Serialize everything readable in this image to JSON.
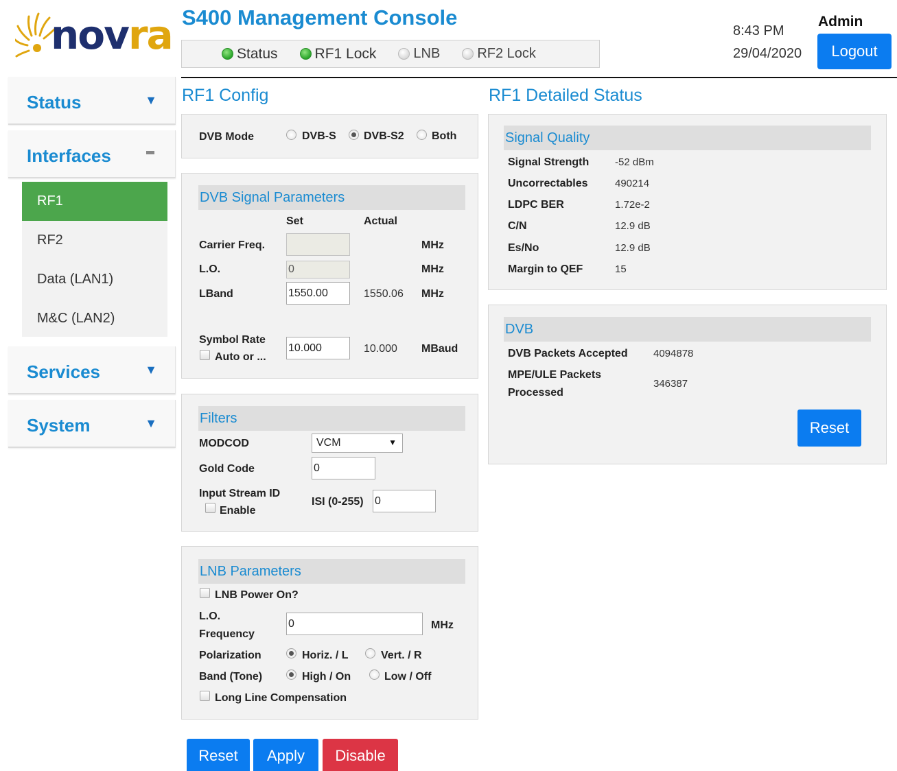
{
  "header": {
    "logo_text": "novra",
    "app_title": "S400 Management Console",
    "time": "8:43 PM",
    "date": "29/04/2020",
    "user": "Admin",
    "logout_label": "Logout"
  },
  "status_indicators": [
    {
      "label": "Status",
      "state": "on"
    },
    {
      "label": "RF1 Lock",
      "state": "on"
    },
    {
      "label": "LNB",
      "state": "off"
    },
    {
      "label": "RF2 Lock",
      "state": "off"
    }
  ],
  "colors": {
    "accent_blue": "#1a8bd1",
    "button_blue": "#0b7cf0",
    "active_green": "#4ca64c",
    "danger_red": "#dc3545",
    "led_on": "#2aa52a"
  },
  "sidebar": {
    "sections": [
      {
        "label": "Status",
        "icon": "chevron-down-icon"
      },
      {
        "label": "Interfaces",
        "icon": "collapse-icon"
      },
      {
        "label": "Services",
        "icon": "chevron-down-icon"
      },
      {
        "label": "System",
        "icon": "chevron-down-icon"
      }
    ],
    "interfaces": [
      "RF1",
      "RF2",
      "Data (LAN1)",
      "M&C (LAN2)"
    ],
    "active_interface": "RF1"
  },
  "rf1_config": {
    "title": "RF1 Config",
    "dvb_mode": {
      "label": "DVB Mode",
      "options": [
        "DVB-S",
        "DVB-S2",
        "Both"
      ],
      "selected": "DVB-S2"
    },
    "signal_params": {
      "title": "DVB Signal Parameters",
      "col_set": "Set",
      "col_actual": "Actual",
      "carrier_freq": {
        "label": "Carrier Freq.",
        "set": "",
        "unit": "MHz"
      },
      "lo": {
        "label": "L.O.",
        "set": "0",
        "unit": "MHz"
      },
      "lband": {
        "label": "LBand",
        "set": "1550.00",
        "actual": "1550.06",
        "unit": "MHz"
      },
      "symbol_rate": {
        "label": "Symbol Rate",
        "auto_label": "Auto or ...",
        "set": "10.000",
        "actual": "10.000",
        "unit": "MBaud"
      }
    },
    "filters": {
      "title": "Filters",
      "modcod_label": "MODCOD",
      "modcod_value": "VCM",
      "gold_code_label": "Gold Code",
      "gold_code_value": "0",
      "isid_label": "Input Stream ID",
      "isid_enable_label": "Enable",
      "isi_label": "ISI (0-255)",
      "isi_value": "0"
    },
    "lnb": {
      "title": "LNB Parameters",
      "power_label": "LNB Power On?",
      "lo_label_1": "L.O.",
      "lo_label_2": "Frequency",
      "lo_value": "0",
      "lo_unit": "MHz",
      "polarization_label": "Polarization",
      "pol_options": [
        "Horiz. / L",
        "Vert. / R"
      ],
      "pol_selected": "Horiz. / L",
      "band_label": "Band (Tone)",
      "band_options": [
        "High / On",
        "Low / Off"
      ],
      "band_selected": "High / On",
      "long_line_label": "Long Line Compensation"
    },
    "buttons": {
      "reset": "Reset",
      "apply": "Apply",
      "disable": "Disable"
    }
  },
  "rf1_status": {
    "title": "RF1 Detailed Status",
    "signal_quality": {
      "title": "Signal Quality",
      "rows": [
        {
          "label": "Signal Strength",
          "value": "-52 dBm"
        },
        {
          "label": "Uncorrectables",
          "value": "490214"
        },
        {
          "label": "LDPC BER",
          "value": "1.72e-2"
        },
        {
          "label": "C/N",
          "value": "12.9 dB"
        },
        {
          "label": "Es/No",
          "value": "12.9 dB"
        },
        {
          "label": "Margin to QEF",
          "value": "15"
        }
      ]
    },
    "dvb": {
      "title": "DVB",
      "accepted_label": "DVB Packets Accepted",
      "accepted_value": "4094878",
      "mpe_label_1": "MPE/ULE Packets",
      "mpe_label_2": "Processed",
      "mpe_value": "346387",
      "reset_label": "Reset"
    }
  }
}
